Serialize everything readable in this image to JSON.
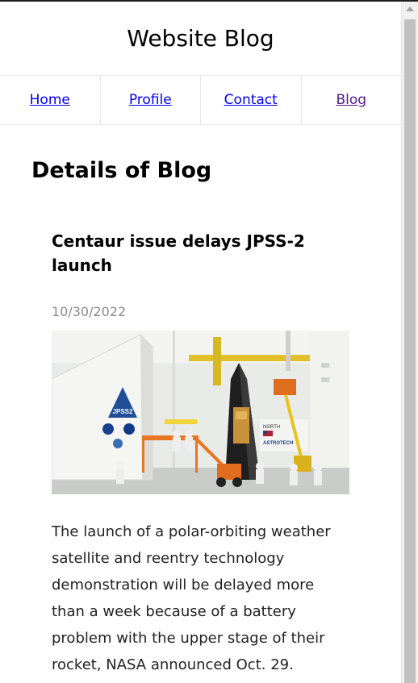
{
  "site": {
    "title": "Website Blog"
  },
  "nav": {
    "items": [
      {
        "label": "Home"
      },
      {
        "label": "Profile"
      },
      {
        "label": "Contact"
      },
      {
        "label": "Blog"
      }
    ]
  },
  "page": {
    "heading": "Details of Blog"
  },
  "post": {
    "title": "Centaur issue delays JPSS-2 launch",
    "date": "10/30/2022",
    "image": {
      "fairing_badge": "JPSS2",
      "sign_top": "NORTH",
      "sign_brand": "ASTROTECH"
    },
    "body": "The launch of a polar-orbiting weather satellite and reentry technology demonstration will be delayed more than a week because of a battery problem with the upper stage of their rocket, NASA announced Oct. 29."
  }
}
